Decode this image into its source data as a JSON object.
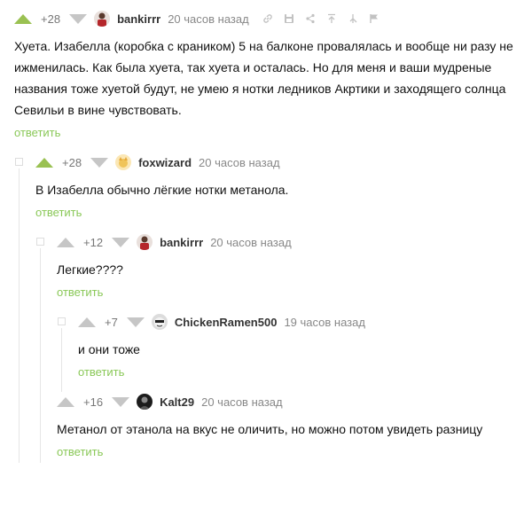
{
  "colors": {
    "accent_green": "#9ac152",
    "reply_green": "#8ac858",
    "muted": "#888888",
    "branch_line": "#e6e6e6"
  },
  "comments": [
    {
      "rating": "+28",
      "nick": "bankirrr",
      "time": "20 часов назад",
      "icons": [
        "link-icon",
        "save-icon",
        "share-icon",
        "parent-icon",
        "thread-icon",
        "report-icon"
      ],
      "text": "Хуета. Изабелла (коробка с краником) 5 на балконе провалялась и вообще ни разу не ижменилась. Как была хуета, так хуета и осталась. Но для меня и ваши мудреные названия тоже хуетой будут, не умею я нотки ледников Акртики и заходящего солнца Севильи в вине чувствовать.",
      "reply": "ответить"
    },
    {
      "rating": "+28",
      "nick": "foxwizard",
      "time": "20 часов назад",
      "text": "В Изабелла обычно лёгкие нотки метанола.",
      "reply": "ответить"
    },
    {
      "rating": "+12",
      "nick": "bankirrr",
      "time": "20 часов назад",
      "text": "Легкие????",
      "reply": "ответить"
    },
    {
      "rating": "+7",
      "nick": "ChickenRamen500",
      "time": "19 часов назад",
      "text": "и они тоже",
      "reply": "ответить"
    },
    {
      "rating": "+16",
      "nick": "Kalt29",
      "time": "20 часов назад",
      "text": "Метанол от этанола на вкус не оличить, но можно потом увидеть разницу",
      "reply": "ответить"
    }
  ]
}
